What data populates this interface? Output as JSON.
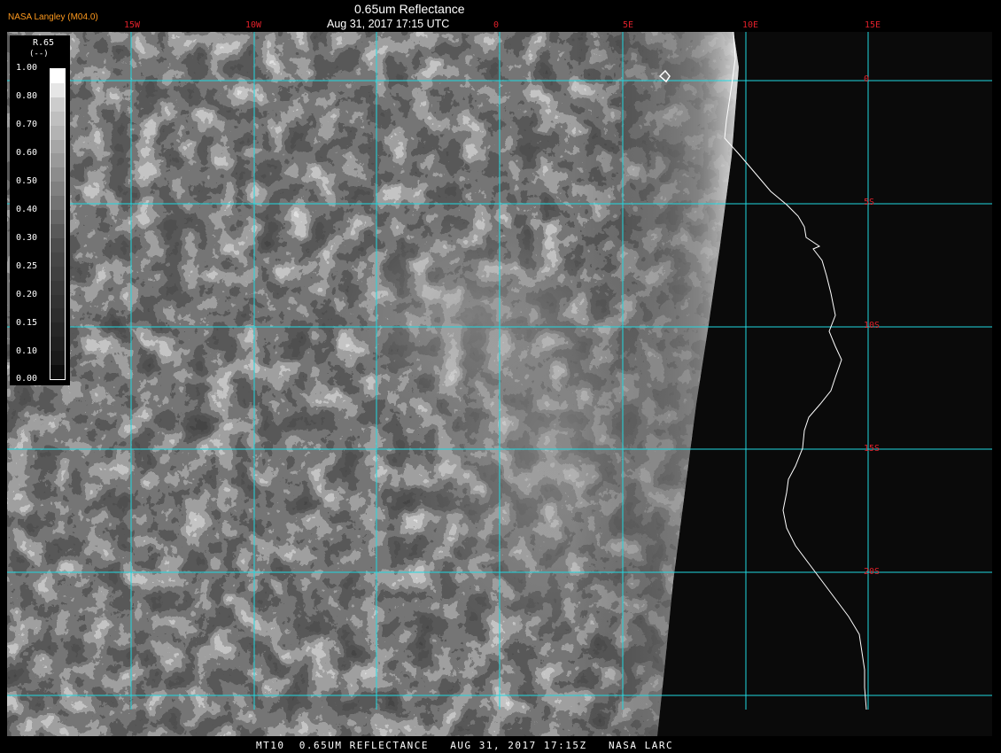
{
  "header": {
    "credit": "NASA Langley (M04.0)",
    "title": "0.65um Reflectance",
    "subtitle": "Aug 31, 2017 17:15 UTC"
  },
  "map": {
    "lon_labels": [
      "15W",
      "10W",
      "0",
      "5E",
      "10E",
      "15E"
    ],
    "lat_labels": [
      "0",
      "5S",
      "10S",
      "15S",
      "20S"
    ],
    "grid_color": "#20d8e0",
    "label_color": "#e0202a",
    "coastline_color": "#ffffff"
  },
  "colorbar": {
    "title": "R.65",
    "units": "(--)",
    "ticks": [
      "1.00",
      "0.80",
      "0.70",
      "0.60",
      "0.50",
      "0.40",
      "0.30",
      "0.25",
      "0.20",
      "0.15",
      "0.10",
      "0.00"
    ],
    "levels": [
      1.0,
      0.9,
      0.8,
      0.75,
      0.7,
      0.65,
      0.6,
      0.55,
      0.5,
      0.45,
      0.4,
      0.35,
      0.3,
      0.275,
      0.25,
      0.225,
      0.2,
      0.175,
      0.15,
      0.125,
      0.1,
      0.05
    ]
  },
  "footer": {
    "text": "MT10  0.65UM REFLECTANCE   AUG 31, 2017 17:15Z   NASA LARC"
  }
}
